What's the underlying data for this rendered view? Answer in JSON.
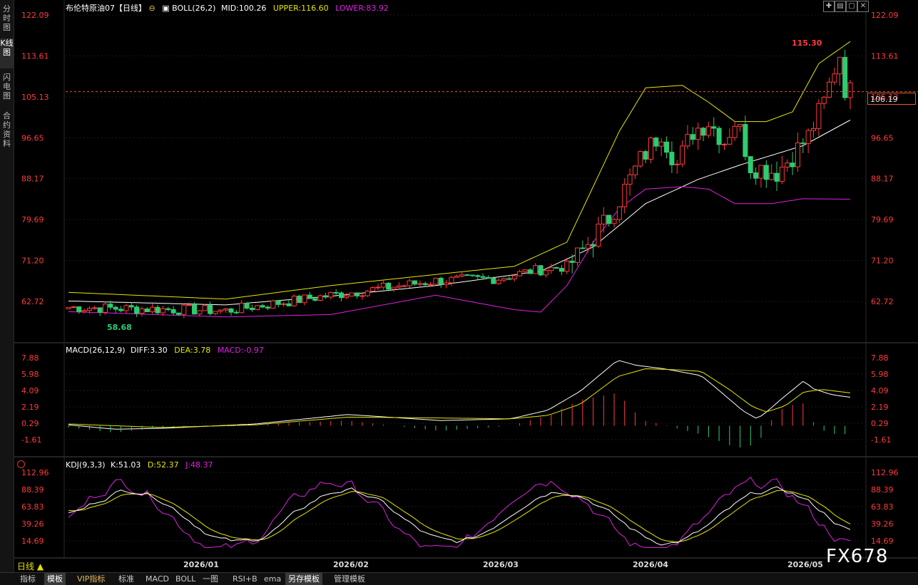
{
  "left_tabs": [
    "分时图",
    "K线图",
    "闪电图",
    "合约资料"
  ],
  "main_panel": {
    "title": "布伦特原油07【日线】",
    "indicator_name": "BOLL(26,2)",
    "mid": "MID:100.26",
    "upper": "UPPER:116.60",
    "lower": "LOWER:83.92",
    "y_ticks": [
      "122.09",
      "113.61",
      "105.13",
      "96.65",
      "88.17",
      "79.69",
      "71.20",
      "62.72"
    ],
    "high_label": "115.30",
    "low_label": "58.68",
    "current_price": "106.19"
  },
  "macd_panel": {
    "indicator_name": "MACD(26,12,9)",
    "diff": "DIFF:3.30",
    "dea": "DEA:3.78",
    "macd": "MACD:-0.97",
    "y_ticks": [
      "7.88",
      "5.98",
      "4.09",
      "2.19",
      "0.29",
      "-1.61"
    ]
  },
  "kdj_panel": {
    "indicator_name": "KDJ(9,3,3)",
    "k": "K:51.03",
    "d": "D:52.37",
    "j": "J:48.37",
    "y_ticks": [
      "112.96",
      "88.39",
      "63.83",
      "39.26",
      "14.69"
    ]
  },
  "x_axis": [
    "2026/01",
    "2026/02",
    "2026/03",
    "2026/04",
    "2026/05"
  ],
  "period_label": "日线",
  "bottom_tabs": [
    "指标",
    "模板",
    "VIP指标",
    "标准",
    "MACD",
    "BOLL",
    "一图",
    "RSI+B",
    "ema",
    "另存模板",
    "管理模板"
  ],
  "watermark": "FX678",
  "colors": {
    "up": "#ff3b3b",
    "down": "#2ecc71",
    "mid_line": "#ffffff",
    "upper_line": "#e6e600",
    "lower_line": "#e020e0",
    "axis_text": "#ff3b3b"
  }
}
